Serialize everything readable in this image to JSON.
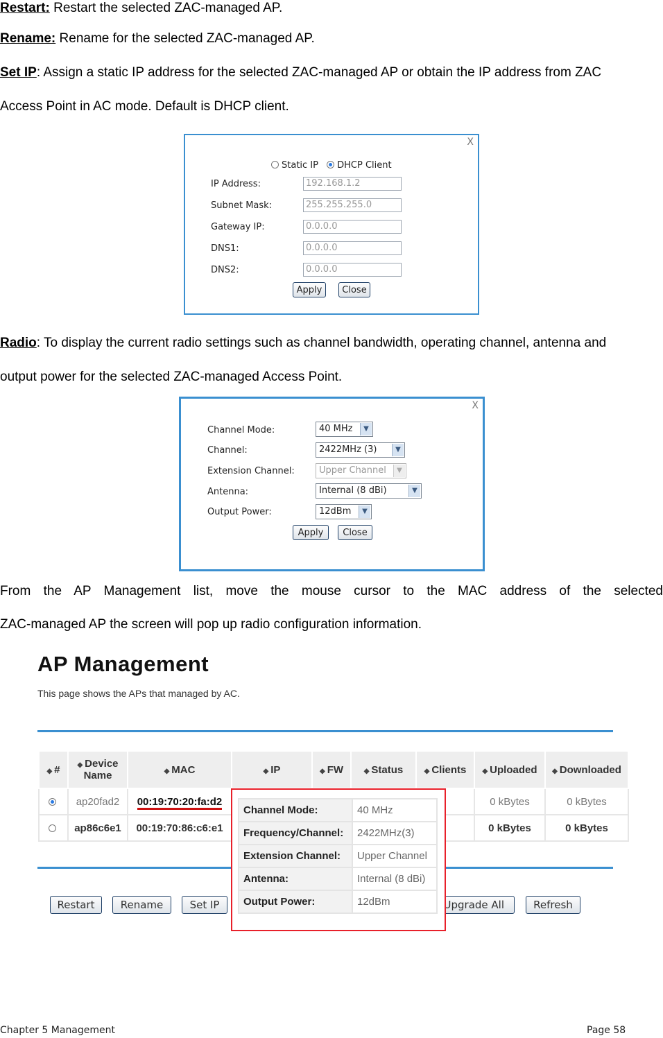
{
  "intro": {
    "restart": {
      "term": "Restart:",
      "text": " Restart the selected ZAC-managed AP."
    },
    "rename": {
      "term": "Rename:",
      "text": " Rename for the selected ZAC-managed AP."
    },
    "setip": {
      "term": "Set IP",
      "text_line1": ": Assign a static IP address for the selected ZAC-managed AP or obtain the IP address from ZAC",
      "text_line2": "Access Point in AC mode.    Default is DHCP client."
    }
  },
  "setip_dialog": {
    "close": "X",
    "static_ip": "Static IP",
    "dhcp_client": "DHCP Client",
    "fields": [
      {
        "label": "IP Address:",
        "value": "192.168.1.2"
      },
      {
        "label": "Subnet Mask:",
        "value": "255.255.255.0"
      },
      {
        "label": "Gateway IP:",
        "value": "0.0.0.0"
      },
      {
        "label": "DNS1:",
        "value": "0.0.0.0"
      },
      {
        "label": "DNS2:",
        "value": "0.0.0.0"
      }
    ],
    "apply": "Apply",
    "close_btn": "Close"
  },
  "radio_desc": {
    "term": "Radio",
    "line1": ": To display the current radio settings such as channel bandwidth, operating channel, antenna and",
    "line2": "output power for the selected ZAC-managed Access Point."
  },
  "radio_dialog": {
    "close": "X",
    "fields": [
      {
        "label": "Channel Mode:",
        "value": "40 MHz"
      },
      {
        "label": "Channel:",
        "value": "2422MHz (3)"
      },
      {
        "label": "Extension Channel:",
        "value": "Upper Channel"
      },
      {
        "label": "Antenna:",
        "value": "Internal (8 dBi)"
      },
      {
        "label": "Output Power:",
        "value": "12dBm"
      }
    ],
    "apply": "Apply",
    "close_btn": "Close"
  },
  "from_text": {
    "line1": "From the AP Management list, move the mouse cursor to the MAC address of the selected",
    "line2": "ZAC-managed AP the screen will pop up radio configuration information."
  },
  "ap_management": {
    "title": "AP Management",
    "subtitle": "This page shows the APs that managed by AC.",
    "columns": [
      "#",
      "Device Name",
      "MAC",
      "IP",
      "FW",
      "Status",
      "Clients",
      "Uploaded",
      "Downloaded"
    ],
    "rows": [
      {
        "device": "ap20fad2",
        "mac": "00:19:70:20:fa:d2",
        "uploaded": "0 kBytes",
        "downloaded": "0 kBytes"
      },
      {
        "device": "ap86c6e1",
        "mac": "00:19:70:86:c6:e1",
        "uploaded": "0 kBytes",
        "downloaded": "0 kBytes"
      }
    ],
    "buttons": [
      "Restart",
      "Rename",
      "Set IP",
      "Upgrade All",
      "Refresh"
    ],
    "popup": [
      {
        "label": "Channel Mode:",
        "value": "40 MHz"
      },
      {
        "label": "Frequency/Channel:",
        "value": "2422MHz(3)"
      },
      {
        "label": "Extension Channel:",
        "value": "Upper Channel"
      },
      {
        "label": "Antenna:",
        "value": "Internal (8 dBi)"
      },
      {
        "label": "Output Power:",
        "value": "12dBm"
      }
    ]
  },
  "footer": {
    "chapter": "Chapter 5 Management",
    "page": "Page 58"
  }
}
